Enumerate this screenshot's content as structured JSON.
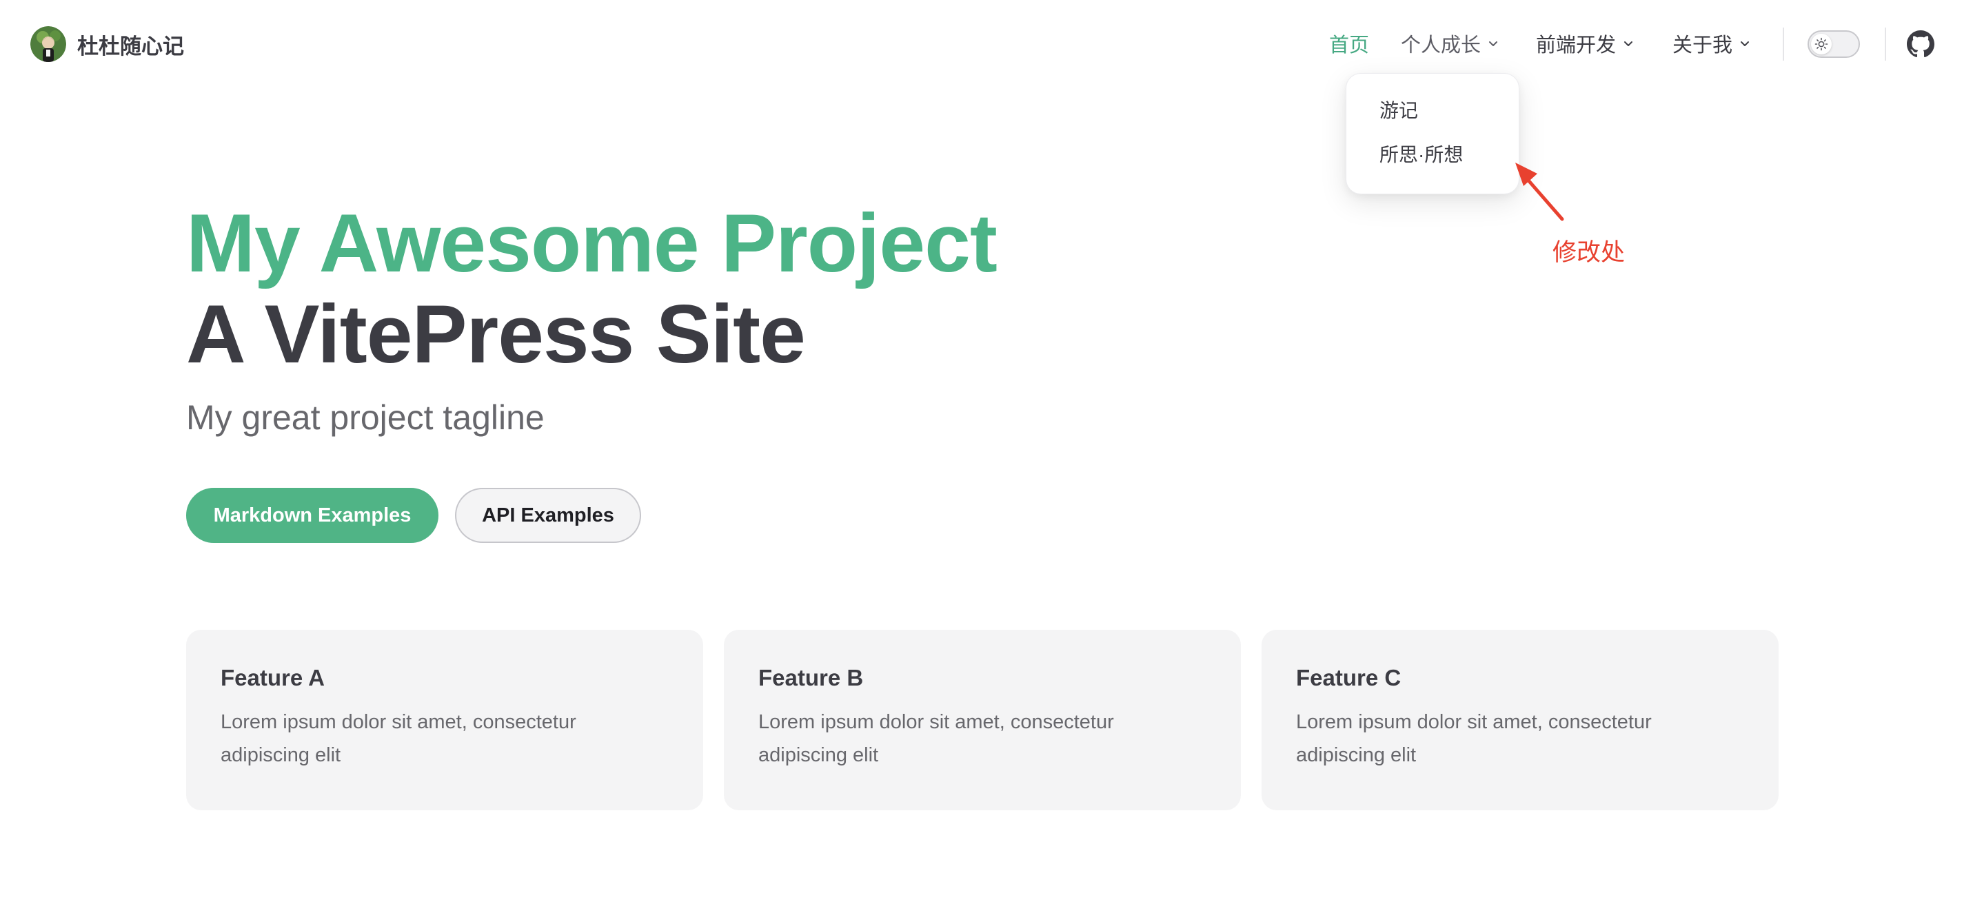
{
  "nav": {
    "title": "杜杜随心记",
    "items": [
      {
        "label": "首页",
        "active": true
      },
      {
        "label": "个人成长",
        "has_dropdown": true
      },
      {
        "label": "前端开发",
        "has_dropdown": true
      },
      {
        "label": "关于我",
        "has_dropdown": true
      }
    ],
    "theme_icon": "sun-icon",
    "social_icon": "github-icon"
  },
  "dropdown": {
    "items": [
      {
        "label": "游记"
      },
      {
        "label": "所思·所想"
      }
    ]
  },
  "annotation": {
    "text": "修改处",
    "color": "#e8412f"
  },
  "hero": {
    "name": "My Awesome Project",
    "text": "A VitePress Site",
    "tagline": "My great project tagline",
    "actions": [
      {
        "label": "Markdown Examples",
        "theme": "brand"
      },
      {
        "label": "API Examples",
        "theme": "alt"
      }
    ]
  },
  "features": [
    {
      "title": "Feature A",
      "details": "Lorem ipsum dolor sit amet, consectetur adipiscing elit"
    },
    {
      "title": "Feature B",
      "details": "Lorem ipsum dolor sit amet, consectetur adipiscing elit"
    },
    {
      "title": "Feature C",
      "details": "Lorem ipsum dolor sit amet, consectetur adipiscing elit"
    }
  ],
  "colors": {
    "brand": "#4cb487",
    "text": "#3c3c43",
    "muted": "#67676c",
    "card_bg": "#f4f4f5"
  }
}
